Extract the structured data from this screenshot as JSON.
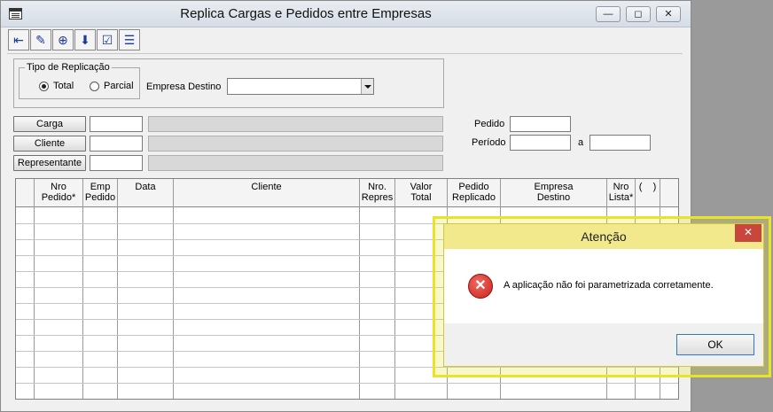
{
  "window": {
    "title": "Replica Cargas e Pedidos entre Empresas"
  },
  "toolbar": {
    "buttons": [
      "exit-icon",
      "pen-icon",
      "binoculars-icon",
      "tray-icon",
      "checklist-icon",
      "list-icon"
    ]
  },
  "tipo_replicacao": {
    "legend": "Tipo de Replicação",
    "total": "Total",
    "parcial": "Parcial",
    "selected": "Total"
  },
  "empresa_destino": {
    "label": "Empresa Destino",
    "value": ""
  },
  "buttons": {
    "carga": "Carga",
    "cliente": "Cliente",
    "representante": "Representante"
  },
  "pedido": {
    "label": "Pedido",
    "value": ""
  },
  "periodo": {
    "label": "Período",
    "sep": "a",
    "from": "",
    "to": ""
  },
  "grid": {
    "columns": [
      "",
      "Nro\nPedido*",
      "Emp\nPedido",
      "Data",
      "Cliente",
      "Nro.\nRepres",
      "Valor\nTotal",
      "Pedido\nReplicado",
      "Empresa\nDestino",
      "Nro\nLista*",
      "(    )"
    ]
  },
  "dialog": {
    "title": "Atenção",
    "close": "✕",
    "message": "A aplicação não foi parametrizada corretamente.",
    "ok": "OK"
  }
}
